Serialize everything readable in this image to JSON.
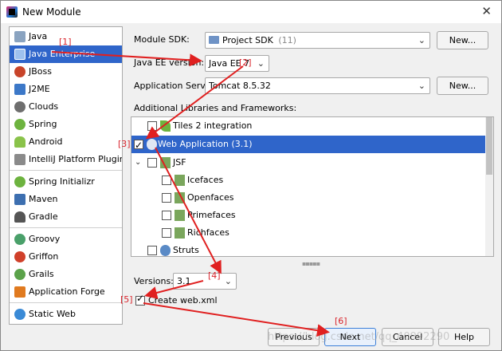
{
  "window": {
    "title": "New Module"
  },
  "sidebar": {
    "items": [
      {
        "label": "Java",
        "icon": "folder-icon",
        "color": "#8aa3c0"
      },
      {
        "label": "Java Enterprise",
        "icon": "java-enterprise-icon",
        "color": "#5b8bd1",
        "selected": true
      },
      {
        "label": "JBoss",
        "icon": "jboss-icon",
        "color": "#c8442a"
      },
      {
        "label": "J2ME",
        "icon": "j2me-icon",
        "color": "#3c78c8"
      },
      {
        "label": "Clouds",
        "icon": "clouds-icon",
        "color": "#6e6e6e"
      },
      {
        "label": "Spring",
        "icon": "spring-icon",
        "color": "#6db33f"
      },
      {
        "label": "Android",
        "icon": "android-icon",
        "color": "#8ac34a"
      },
      {
        "label": "IntelliJ Platform Plugin",
        "icon": "plugin-icon",
        "color": "#8a8a8a"
      },
      {
        "label": "Spring Initializr",
        "icon": "spring-initializr-icon",
        "color": "#6db33f"
      },
      {
        "label": "Maven",
        "icon": "maven-icon",
        "color": "#3d6fb0"
      },
      {
        "label": "Gradle",
        "icon": "gradle-icon",
        "color": "#555555"
      },
      {
        "label": "Groovy",
        "icon": "groovy-icon",
        "color": "#4aa06a"
      },
      {
        "label": "Griffon",
        "icon": "griffon-icon",
        "color": "#d0402a"
      },
      {
        "label": "Grails",
        "icon": "grails-icon",
        "color": "#5ba24a"
      },
      {
        "label": "Application Forge",
        "icon": "application-forge-icon",
        "color": "#e07a1f"
      },
      {
        "label": "Static Web",
        "icon": "static-web-icon",
        "color": "#3a8ad6"
      }
    ]
  },
  "form": {
    "sdk_label": "Module SDK:",
    "sdk_value": "Project SDK",
    "sdk_version": "(11)",
    "new_button": "New...",
    "javaee_label": "Java EE version:",
    "javaee_value": "Java EE 7",
    "appserver_label": "Application Server:",
    "appserver_value": "Tomcat 8.5.32",
    "libraries_label": "Additional Libraries and Frameworks:"
  },
  "libraries": {
    "items": [
      {
        "label": "Tiles 2 integration",
        "checked": false
      },
      {
        "label": "Web Application (3.1)",
        "checked": true,
        "selected": true
      },
      {
        "label": "JSF",
        "checked": false
      },
      {
        "label": "Icefaces",
        "checked": false
      },
      {
        "label": "Openfaces",
        "checked": false
      },
      {
        "label": "Primefaces",
        "checked": false
      },
      {
        "label": "Richfaces",
        "checked": false
      },
      {
        "label": "Struts",
        "checked": false
      }
    ]
  },
  "options": {
    "versions_label": "Versions:",
    "versions_value": "3.1",
    "create_webxml_label": "Create web.xml",
    "create_webxml_checked": true
  },
  "footer": {
    "previous": "Previous",
    "next": "Next",
    "cancel": "Cancel",
    "help": "Help"
  },
  "annotations": {
    "a1": "[1]",
    "a2": "[2]",
    "a3": "[3]",
    "a4": "[4]",
    "a5": "[5]",
    "a6": "[6]",
    "color": "#e02020"
  },
  "watermark": "https://blog.csdn.net/qq_40992290"
}
